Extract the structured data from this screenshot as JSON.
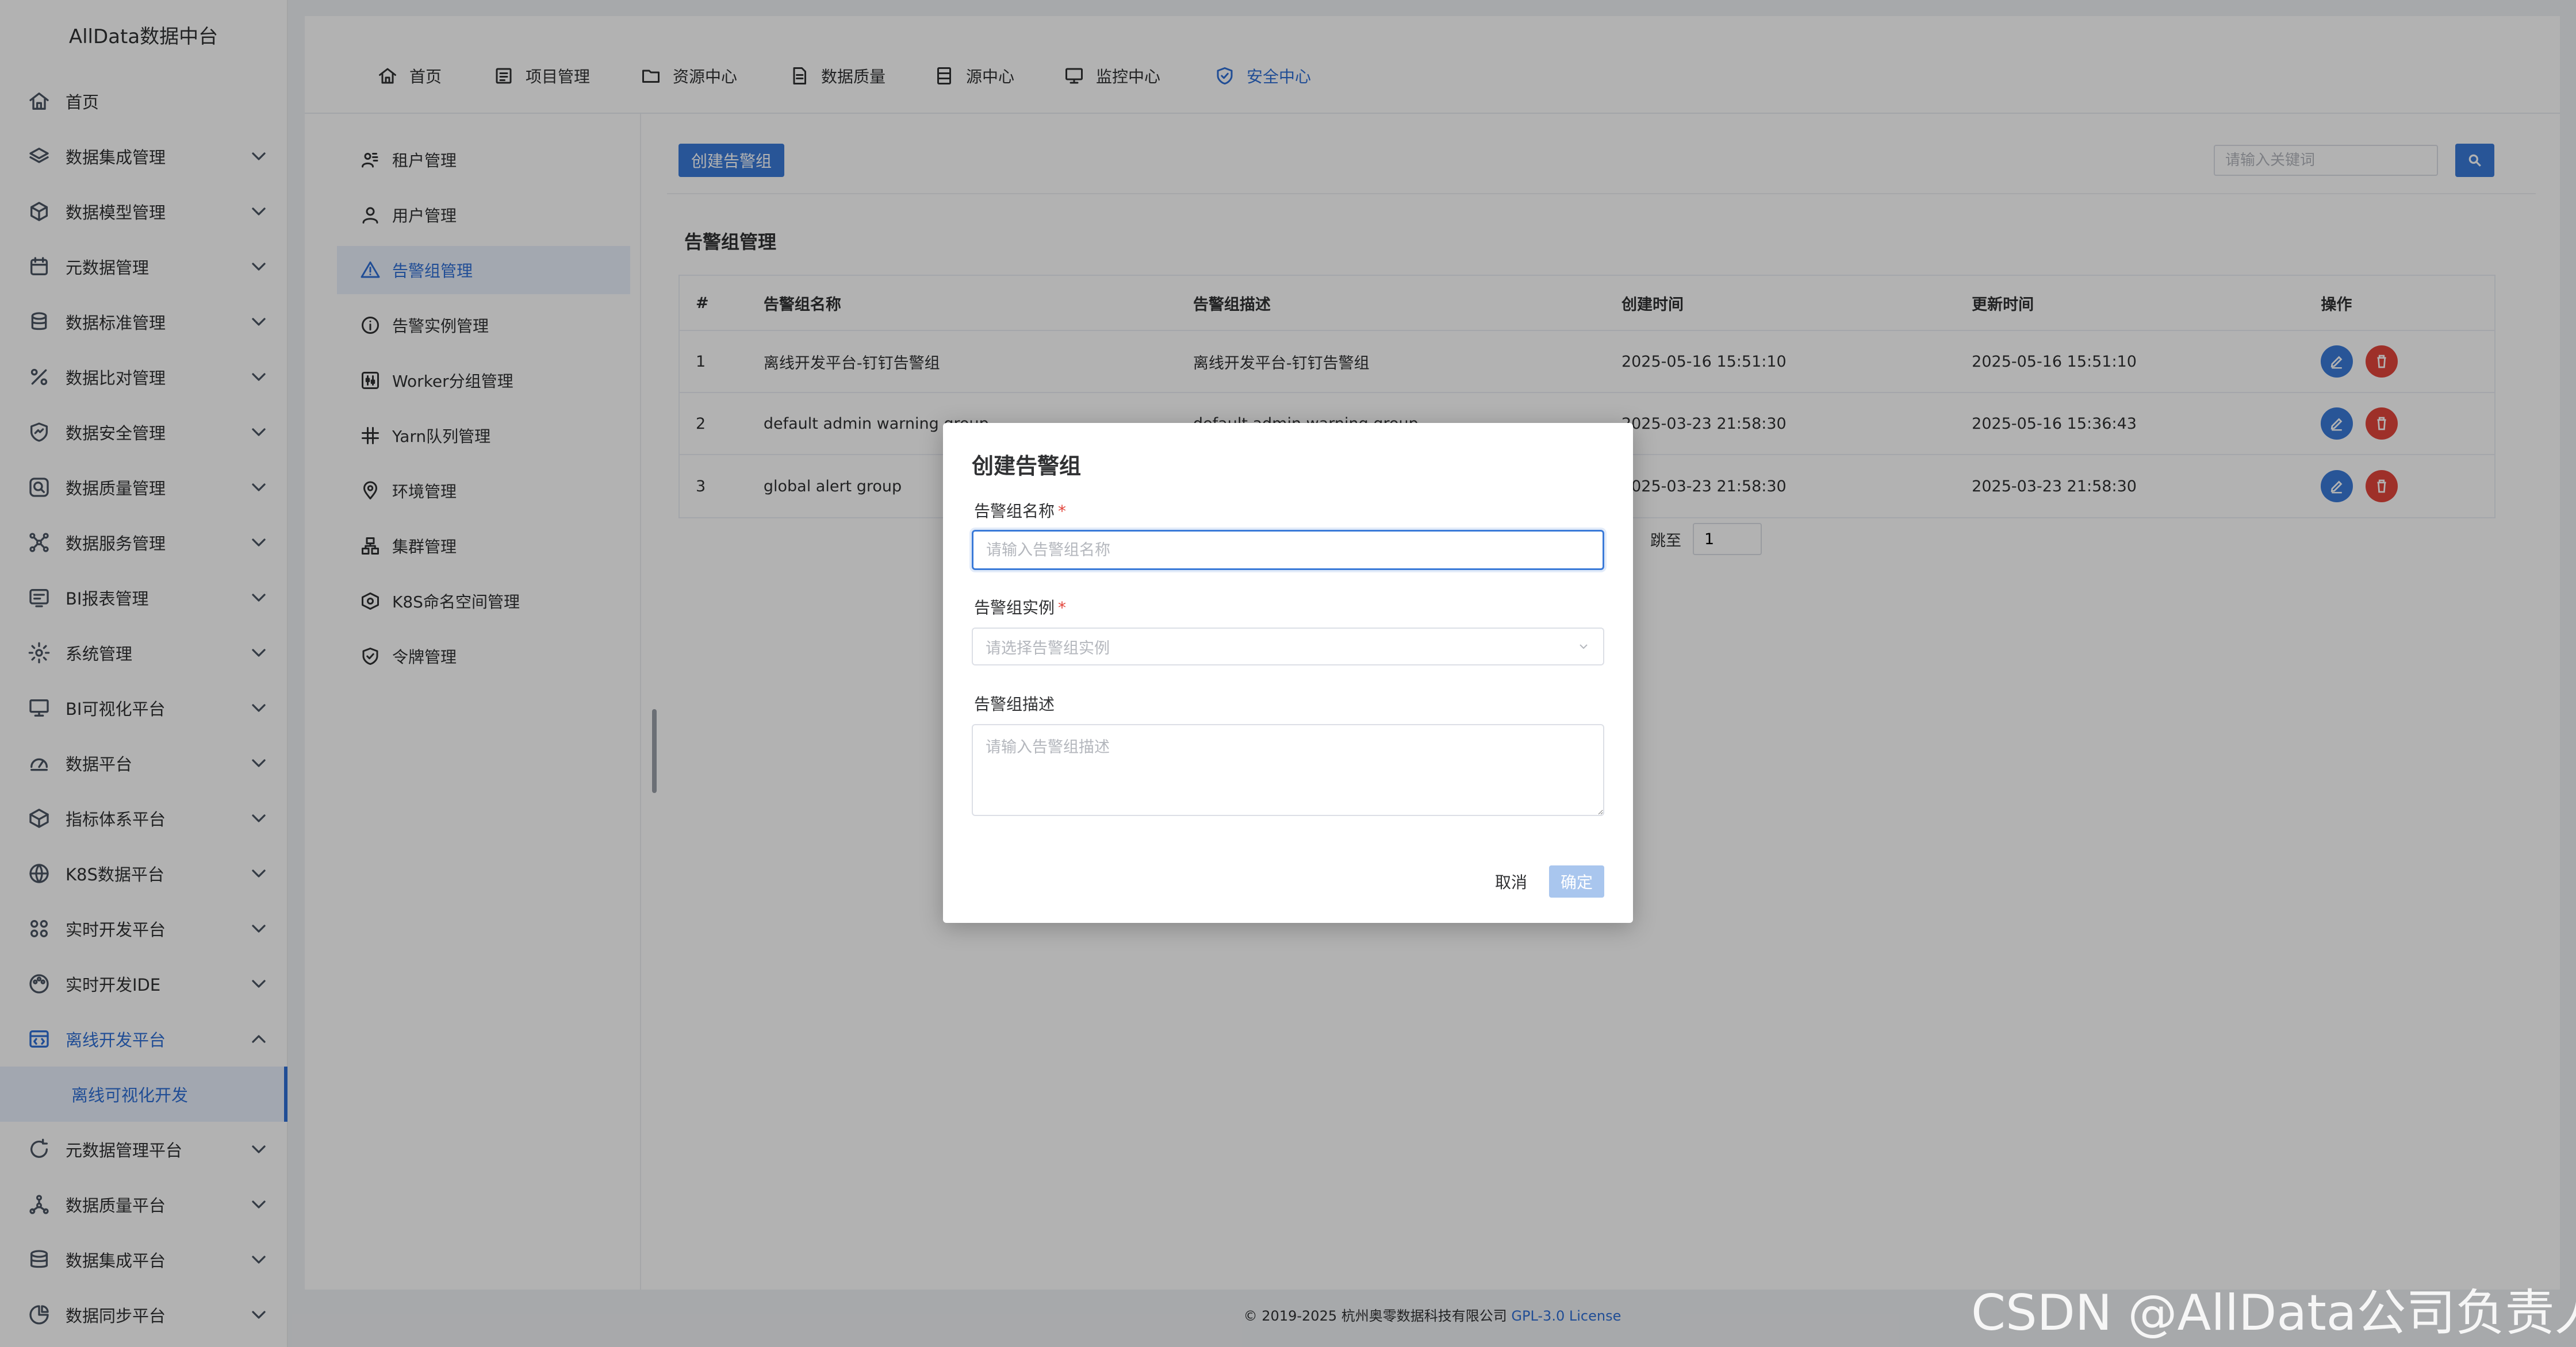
{
  "app": {
    "brand": "AllData数据中台"
  },
  "sidebar": {
    "items": [
      {
        "label": "首页",
        "icon": "home-icon",
        "has_children": false
      },
      {
        "label": "数据集成管理",
        "icon": "layers-icon",
        "has_children": true
      },
      {
        "label": "数据模型管理",
        "icon": "cube-icon",
        "has_children": true
      },
      {
        "label": "元数据管理",
        "icon": "calendar-icon",
        "has_children": true
      },
      {
        "label": "数据标准管理",
        "icon": "database-icon",
        "has_children": true
      },
      {
        "label": "数据比对管理",
        "icon": "percent-icon",
        "has_children": true
      },
      {
        "label": "数据安全管理",
        "icon": "shield-chart-icon",
        "has_children": true
      },
      {
        "label": "数据质量管理",
        "icon": "search-box-icon",
        "has_children": true
      },
      {
        "label": "数据服务管理",
        "icon": "network-icon",
        "has_children": true
      },
      {
        "label": "BI报表管理",
        "icon": "report-icon",
        "has_children": true
      },
      {
        "label": "系统管理",
        "icon": "gear-icon",
        "has_children": true
      },
      {
        "label": "BI可视化平台",
        "icon": "monitor-icon",
        "has_children": true
      },
      {
        "label": "数据平台",
        "icon": "dashboard-icon",
        "has_children": true
      },
      {
        "label": "指标体系平台",
        "icon": "box-icon",
        "has_children": true
      },
      {
        "label": "K8S数据平台",
        "icon": "globe-icon",
        "has_children": true
      },
      {
        "label": "实时开发平台",
        "icon": "nodes-icon",
        "has_children": true
      },
      {
        "label": "实时开发IDE",
        "icon": "palette-icon",
        "has_children": true
      },
      {
        "label": "离线开发平台",
        "icon": "code-window-icon",
        "has_children": true,
        "open": true
      },
      {
        "label": "元数据管理平台",
        "icon": "refresh-ring-icon",
        "has_children": true
      },
      {
        "label": "数据质量平台",
        "icon": "graph-icon",
        "has_children": true
      },
      {
        "label": "数据集成平台",
        "icon": "stack-icon",
        "has_children": true
      },
      {
        "label": "数据同步平台",
        "icon": "pie-icon",
        "has_children": true
      }
    ],
    "sub_item": "离线可视化开发"
  },
  "topnav": {
    "items": [
      {
        "label": "首页",
        "icon": "home-icon"
      },
      {
        "label": "项目管理",
        "icon": "list-icon"
      },
      {
        "label": "资源中心",
        "icon": "folder-icon"
      },
      {
        "label": "数据质量",
        "icon": "document-icon"
      },
      {
        "label": "源中心",
        "icon": "server-icon"
      },
      {
        "label": "监控中心",
        "icon": "monitor-icon"
      },
      {
        "label": "安全中心",
        "icon": "shield-check-icon",
        "active": true
      }
    ]
  },
  "subnav": {
    "items": [
      {
        "label": "租户管理",
        "icon": "users-icon"
      },
      {
        "label": "用户管理",
        "icon": "user-icon"
      },
      {
        "label": "告警组管理",
        "icon": "warning-icon",
        "active": true
      },
      {
        "label": "告警实例管理",
        "icon": "info-icon"
      },
      {
        "label": "Worker分组管理",
        "icon": "worker-icon"
      },
      {
        "label": "Yarn队列管理",
        "icon": "slack-icon"
      },
      {
        "label": "环境管理",
        "icon": "location-icon"
      },
      {
        "label": "集群管理",
        "icon": "cluster-icon"
      },
      {
        "label": "K8S命名空间管理",
        "icon": "namespace-icon"
      },
      {
        "label": "令牌管理",
        "icon": "token-shield-icon"
      }
    ]
  },
  "toolbar": {
    "create_label": "创建告警组",
    "search_placeholder": "请输入关键词"
  },
  "section": {
    "title": "告警组管理"
  },
  "table": {
    "columns": [
      "#",
      "告警组名称",
      "告警组描述",
      "创建时间",
      "更新时间",
      "操作"
    ],
    "rows": [
      {
        "idx": "1",
        "name": "离线开发平台-钉钉告警组",
        "desc": "离线开发平台-钉钉告警组",
        "created": "2025-05-16 15:51:10",
        "updated": "2025-05-16 15:51:10"
      },
      {
        "idx": "2",
        "name": "default admin warning group",
        "desc": "default admin warning group",
        "created": "2025-03-23 21:58:30",
        "updated": "2025-05-16 15:36:43"
      },
      {
        "idx": "3",
        "name": "global alert group",
        "desc": "global alert group",
        "created": "2025-03-23 21:58:30",
        "updated": "2025-03-23 21:58:30"
      }
    ]
  },
  "pager": {
    "jump_label": "跳至",
    "page_value": "1"
  },
  "footer": {
    "copyright": "© 2019-2025 杭州奥零数据科技有限公司",
    "license": "GPL-3.0 License"
  },
  "dialog": {
    "title": "创建告警组",
    "name_label": "告警组名称",
    "name_placeholder": "请输入告警组名称",
    "instance_label": "告警组实例",
    "instance_placeholder": "请选择告警组实例",
    "desc_label": "告警组描述",
    "desc_placeholder": "请输入告警组描述",
    "required_mark": "*",
    "cancel_label": "取消",
    "ok_label": "确定"
  },
  "watermark": "CSDN @AllData公司负责人",
  "colors": {
    "primary": "#3a7ad8",
    "danger": "#e2453c",
    "active_text": "#2f6fd6"
  }
}
